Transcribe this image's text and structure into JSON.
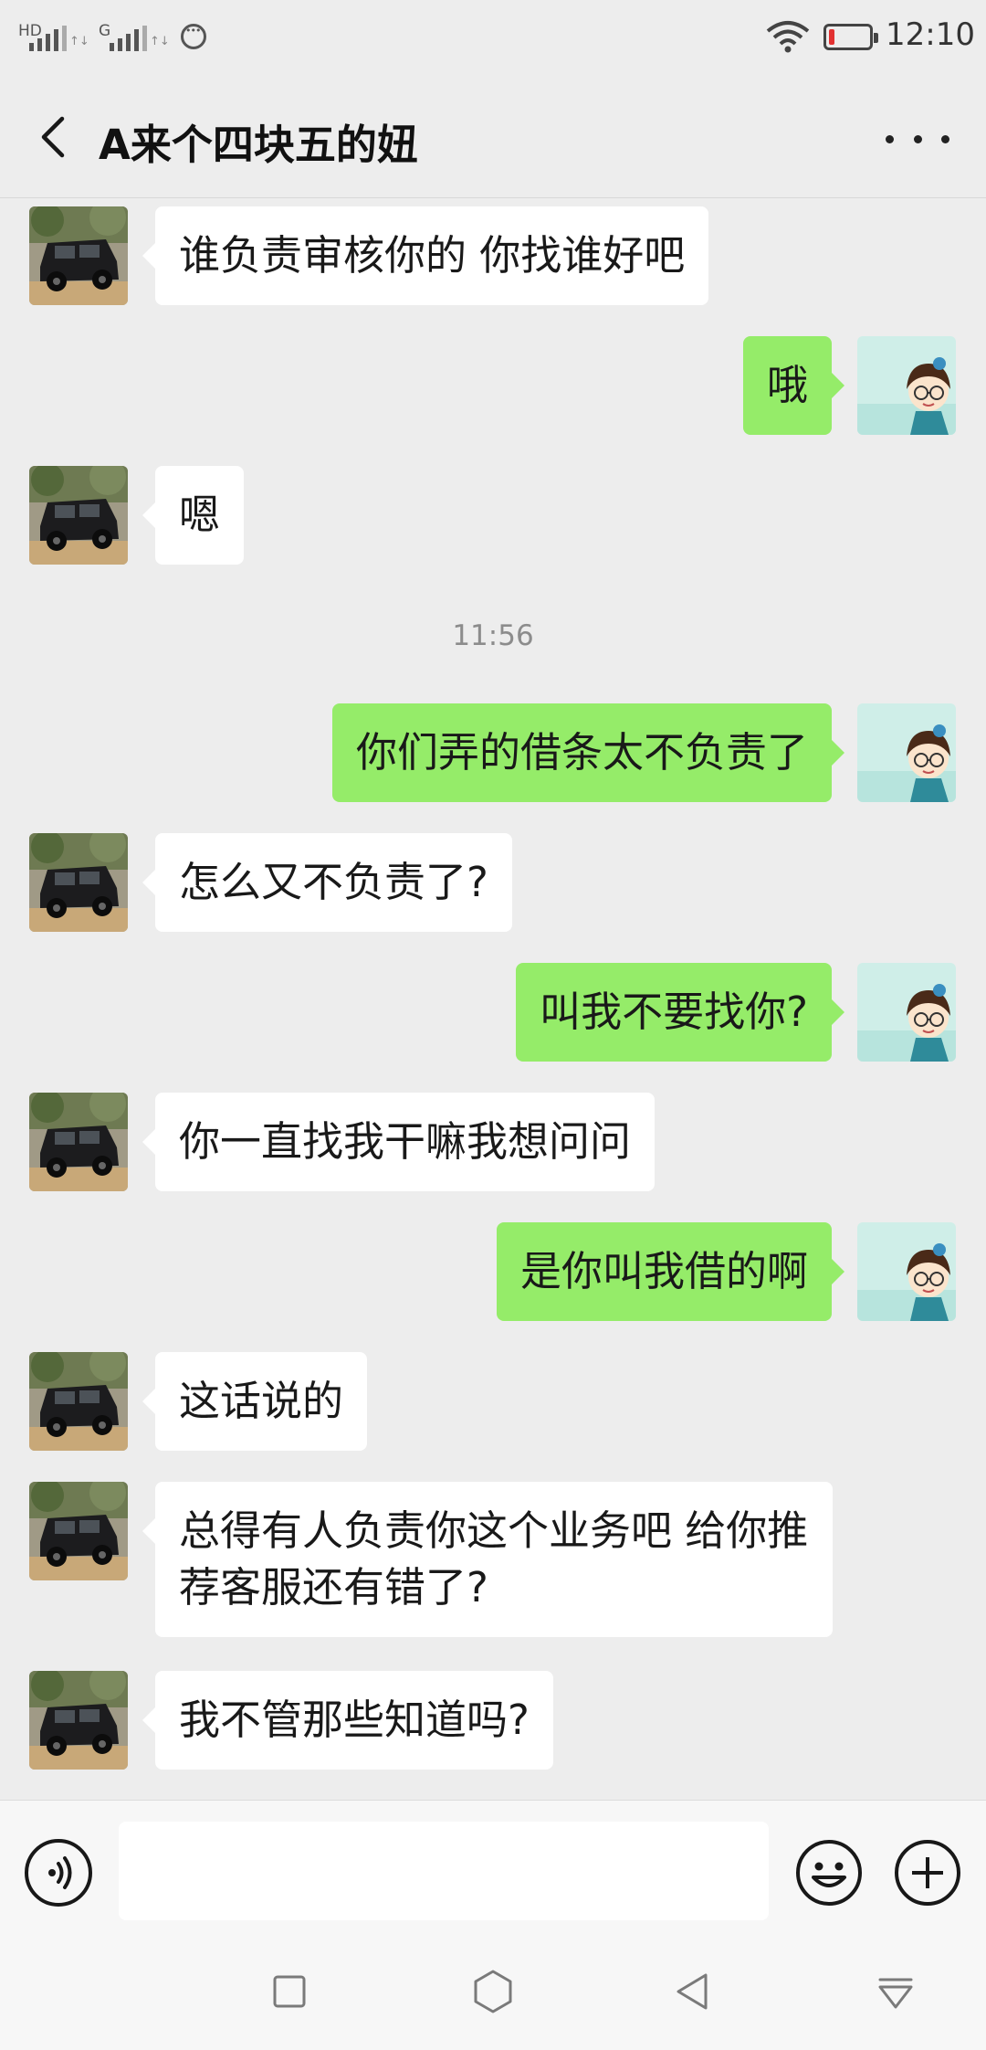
{
  "status_bar": {
    "sim1_label": "HD",
    "sim2_label": "G",
    "time": "12:10",
    "icons": [
      "signal-icon",
      "signal-icon",
      "wechat-icon",
      "wifi-icon",
      "battery-low-icon"
    ],
    "battery_color": "#e23131"
  },
  "header": {
    "title": "A来个四块五的妞",
    "back_icon": "chevron-left-icon",
    "more_icon": "more-dots-icon"
  },
  "colors": {
    "background": "#ededed",
    "sent_bubble": "#95ec69",
    "received_bubble": "#ffffff"
  },
  "conversation": {
    "timestamp": "11:56",
    "messages": [
      {
        "direction": "received",
        "text": "谁负责审核你的 你找谁好吧"
      },
      {
        "direction": "sent",
        "text": "哦"
      },
      {
        "direction": "received",
        "text": "嗯"
      },
      {
        "direction": "sent",
        "text": "你们弄的借条太不负责了"
      },
      {
        "direction": "received",
        "text": "怎么又不负责了?"
      },
      {
        "direction": "sent",
        "text": "叫我不要找你?"
      },
      {
        "direction": "received",
        "text": "你一直找我干嘛我想问问"
      },
      {
        "direction": "sent",
        "text": "是你叫我借的啊"
      },
      {
        "direction": "received",
        "text": "这话说的"
      },
      {
        "direction": "received",
        "text": "总得有人负责你这个业务吧 给你推荐客服还有错了?"
      },
      {
        "direction": "received",
        "text": "我不管那些知道吗?"
      }
    ]
  },
  "input_bar": {
    "value": "",
    "placeholder": "",
    "icons": [
      "voice-icon",
      "emoji-icon",
      "plus-icon"
    ]
  },
  "nav_bar": {
    "icons": [
      "recent-apps-icon",
      "home-icon",
      "back-nav-icon",
      "notification-icon"
    ]
  }
}
